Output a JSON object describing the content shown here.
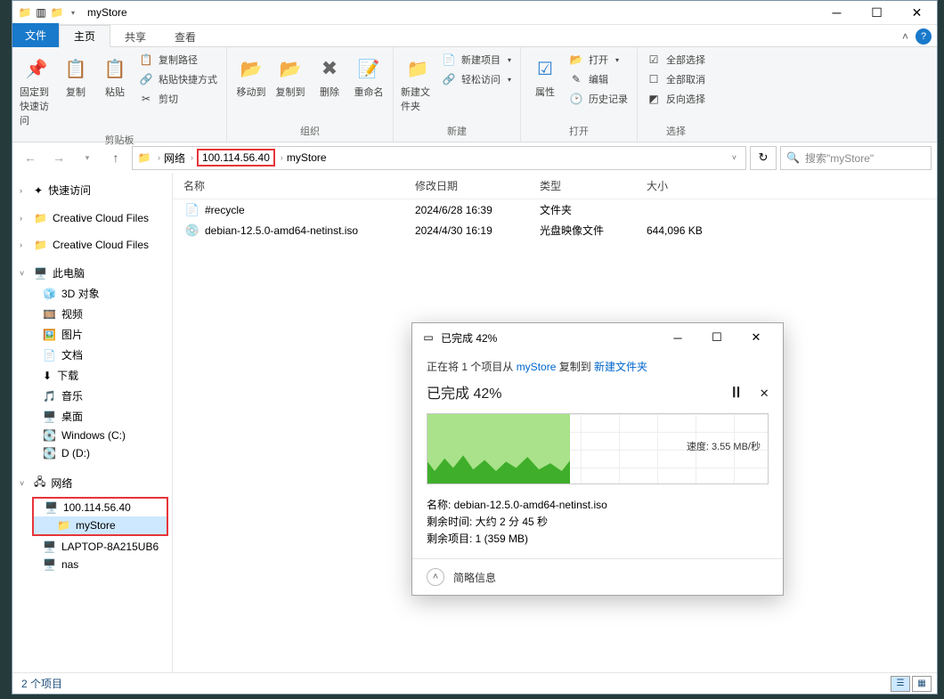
{
  "window": {
    "title": "myStore"
  },
  "tabs": {
    "file": "文件",
    "home": "主页",
    "share": "共享",
    "view": "查看"
  },
  "ribbon": {
    "clipboard": {
      "label": "剪贴板",
      "pin": "固定到快速访问",
      "copy": "复制",
      "paste": "粘贴",
      "copy_path": "复制路径",
      "paste_shortcut": "粘贴快捷方式",
      "cut": "剪切"
    },
    "organize": {
      "label": "组织",
      "move_to": "移动到",
      "copy_to": "复制到",
      "delete": "删除",
      "rename": "重命名"
    },
    "new": {
      "label": "新建",
      "new_folder": "新建文件夹",
      "new_item": "新建项目",
      "easy_access": "轻松访问"
    },
    "open": {
      "label": "打开",
      "properties": "属性",
      "open": "打开",
      "edit": "编辑",
      "history": "历史记录"
    },
    "select": {
      "label": "选择",
      "select_all": "全部选择",
      "select_none": "全部取消",
      "invert": "反向选择"
    }
  },
  "address": {
    "root": "网络",
    "ip": "100.114.56.40",
    "folder": "myStore"
  },
  "search": {
    "placeholder": "搜索\"myStore\""
  },
  "nav": {
    "quick_access": "快速访问",
    "ccf1": "Creative Cloud Files",
    "ccf2": "Creative Cloud Files",
    "this_pc": "此电脑",
    "threed": "3D 对象",
    "videos": "视频",
    "pictures": "图片",
    "documents": "文档",
    "downloads": "下载",
    "music": "音乐",
    "desktop": "桌面",
    "windows_c": "Windows (C:)",
    "d_drive": "D (D:)",
    "network": "网络",
    "ip_node": "100.114.56.40",
    "mystore": "myStore",
    "laptop": "LAPTOP-8A215UB6",
    "nas": "nas"
  },
  "columns": {
    "name": "名称",
    "date": "修改日期",
    "type": "类型",
    "size": "大小"
  },
  "files": [
    {
      "icon": "file",
      "name": "#recycle",
      "date": "2024/6/28 16:39",
      "type": "文件夹",
      "size": ""
    },
    {
      "icon": "disc",
      "name": "debian-12.5.0-amd64-netinst.iso",
      "date": "2024/4/30 16:19",
      "type": "光盘映像文件",
      "size": "644,096 KB"
    }
  ],
  "status": {
    "count": "2 个项目"
  },
  "dialog": {
    "title": "已完成 42%",
    "action_pre": "正在将 1 个项目从 ",
    "action_src": "myStore",
    "action_mid": " 复制到 ",
    "action_dst": "新建文件夹",
    "progress_title": "已完成 42%",
    "speed_label": "速度: ",
    "speed_value": "3.55 MB/秒",
    "name_label": "名称: ",
    "name_value": "debian-12.5.0-amd64-netinst.iso",
    "remain_time_label": "剩余时间: ",
    "remain_time_value": "大约 2 分 45 秒",
    "remain_items_label": "剩余项目: ",
    "remain_items_value": "1 (359 MB)",
    "more": "简略信息",
    "progress_percent": 42
  }
}
